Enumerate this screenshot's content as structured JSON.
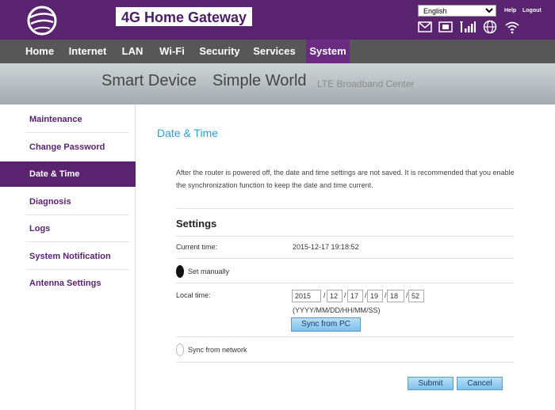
{
  "header": {
    "title": "4G Home Gateway",
    "language_selected": "English",
    "help_label": "Help",
    "logout_label": "Logout",
    "icons": [
      "mail-icon",
      "sim-icon",
      "signal-icon",
      "globe-icon",
      "wifi-icon"
    ]
  },
  "nav": {
    "items": [
      "Home",
      "Internet",
      "LAN",
      "Wi-Fi",
      "Security",
      "Services",
      "System"
    ],
    "active": "System"
  },
  "banner": {
    "slogan_part1": "Smart Device",
    "slogan_part2": "Simple World",
    "slogan_part3": "LTE Broadband Center"
  },
  "sidebar": {
    "items": [
      "Maintenance",
      "Change Password",
      "Date & Time",
      "Diagnosis",
      "Logs",
      "System Notification",
      "Antenna Settings"
    ],
    "active": "Date & Time"
  },
  "main": {
    "title": "Date & Time",
    "description": "After the router is powered off, the date and time settings are not saved. It is recommended that you enable the synchronization function to keep the date and time current.",
    "settings_heading": "Settings",
    "current_time_label": "Current time:",
    "current_time_value": "2015-12-17 19:18:52",
    "set_manually_label": "Set manually",
    "local_time_label": "Local time:",
    "local_time_fields": [
      "2015",
      "12",
      "17",
      "19",
      "18",
      "52"
    ],
    "separator": "/",
    "format_hint": "(YYYY/MM/DD/HH/MM/SS)",
    "sync_pc_label": "Sync from PC",
    "sync_network_label": "Sync from network",
    "submit_label": "Submit",
    "cancel_label": "Cancel"
  },
  "colors": {
    "header_bg": "#5a2370",
    "nav_bg": "#575757",
    "nav_active": "#6b2b80",
    "title_color": "#2aa0d0",
    "button_blue": "#7cc1ea"
  }
}
